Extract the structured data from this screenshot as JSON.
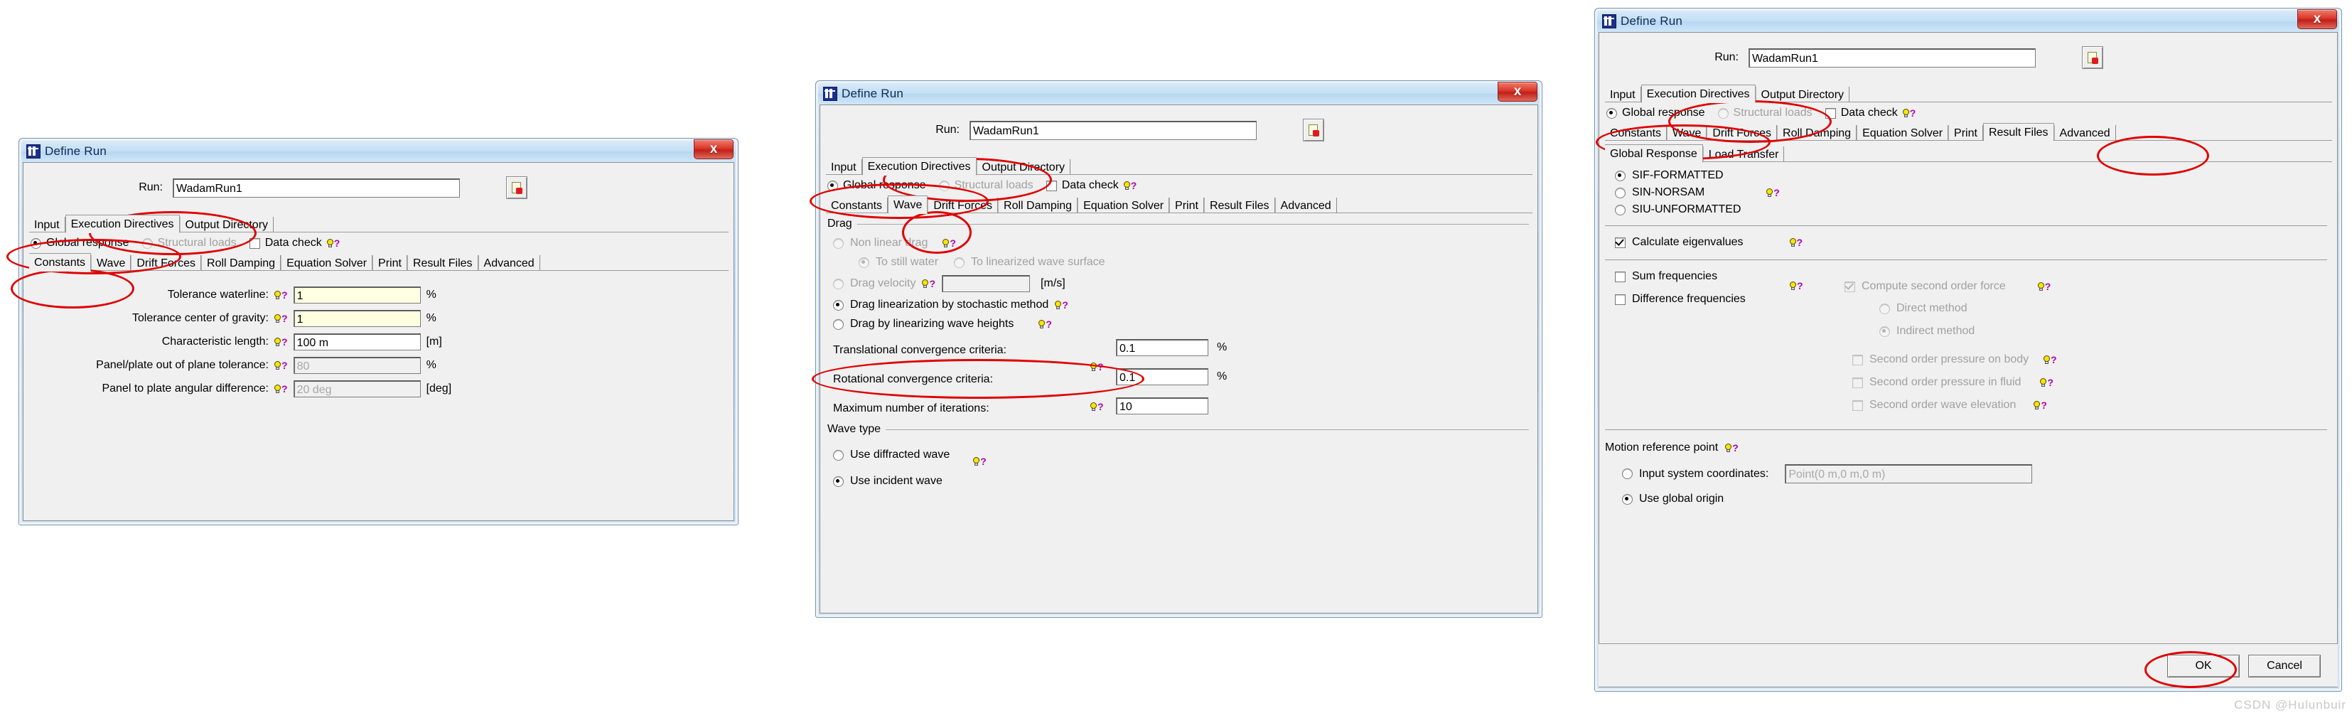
{
  "window_title": "Define Run",
  "common": {
    "run_label": "Run:",
    "run_value": "WadamRun1",
    "top_tabs": [
      "Input",
      "Execution Directives",
      "Output Directory"
    ],
    "mode_global": "Global response",
    "mode_structural": "Structural loads",
    "data_check": "Data check",
    "sub_tabs": [
      "Constants",
      "Wave",
      "Drift Forces",
      "Roll Damping",
      "Equation Solver",
      "Print",
      "Result Files",
      "Advanced"
    ],
    "close_glyph": "x"
  },
  "dialog1": {
    "selected_top_tab": "Execution Directives",
    "selected_sub_tab": "Constants",
    "fields": [
      {
        "label": "Tolerance waterline:",
        "value": "1",
        "unit": "%",
        "style": "yellow"
      },
      {
        "label": "Tolerance center of gravity:",
        "value": "1",
        "unit": "%",
        "style": "yellow"
      },
      {
        "label": "Characteristic length:",
        "value": "100 m",
        "unit": "[m]",
        "style": "normal"
      },
      {
        "label": "Panel/plate out of plane tolerance:",
        "value": "80",
        "unit": "%",
        "style": "disabled"
      },
      {
        "label": "Panel to plate angular difference:",
        "value": "20 deg",
        "unit": "[deg]",
        "style": "disabled"
      }
    ]
  },
  "dialog2": {
    "selected_top_tab": "Execution Directives",
    "selected_sub_tab": "Wave",
    "drag_group": "Drag",
    "non_linear_drag": "Non linear drag",
    "to_still_water": "To still water",
    "to_linearized_wave_surface": "To linearized wave surface",
    "drag_velocity": "Drag velocity",
    "drag_velocity_value": "",
    "drag_velocity_unit": "[m/s]",
    "drag_linearization": "Drag linearization by stochastic method",
    "drag_by_linearizing": "Drag by linearizing wave heights",
    "translational_label": "Translational convergence criteria:",
    "translational_value": "0.1",
    "translational_unit": "%",
    "rotational_label": "Rotational convergence criteria:",
    "rotational_value": "0.1",
    "rotational_unit": "%",
    "max_iter_label": "Maximum number of iterations:",
    "max_iter_value": "10",
    "wave_type_group": "Wave type",
    "use_diffracted_wave": "Use diffracted wave",
    "use_incident_wave": "Use incident wave"
  },
  "dialog3": {
    "selected_top_tab": "Execution Directives",
    "selected_sub_tab": "Result Files",
    "inner_tabs": [
      "Global Response",
      "Load Transfer"
    ],
    "selected_inner_tab": "Global Response",
    "format_options": [
      "SIF-FORMATTED",
      "SIN-NORSAM",
      "SIU-UNFORMATTED"
    ],
    "selected_format": "SIF-FORMATTED",
    "calculate_eigenvalues": "Calculate eigenvalues",
    "sum_frequencies": "Sum frequencies",
    "difference_frequencies": "Difference frequencies",
    "compute_second_order_force": "Compute second order force",
    "direct_method": "Direct method",
    "indirect_method": "Indirect method",
    "second_order_pressure_body": "Second order pressure on body",
    "second_order_pressure_fluid": "Second order pressure in fluid",
    "second_order_wave_elevation": "Second order wave elevation",
    "motion_reference_point": "Motion reference point",
    "input_system_coordinates": "Input system coordinates:",
    "point_value": "Point(0 m,0 m,0 m)",
    "use_global_origin": "Use global origin",
    "ok_label": "OK",
    "cancel_label": "Cancel"
  },
  "watermark": "CSDN @Hulunbuir",
  "colors": {
    "accent_red": "#e00000",
    "title_blue": "#0d2a57",
    "field_yellow": "#ffffe1"
  }
}
